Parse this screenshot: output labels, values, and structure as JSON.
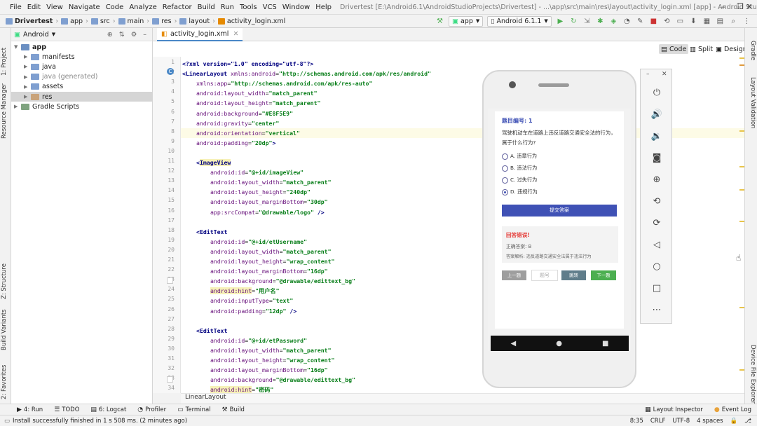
{
  "menubar": {
    "items": [
      "File",
      "Edit",
      "View",
      "Navigate",
      "Code",
      "Analyze",
      "Refactor",
      "Build",
      "Run",
      "Tools",
      "VCS",
      "Window",
      "Help"
    ],
    "title": "Drivertest [E:\\Android6.1\\AndroidStudioProjects\\Drivertest] - ...\\app\\src\\main\\res\\layout\\activity_login.xml [app] - Android Studio"
  },
  "breadcrumbs": [
    "Drivertest",
    "app",
    "src",
    "main",
    "res",
    "layout",
    "activity_login.xml"
  ],
  "toolbar": {
    "run_config": "app",
    "device": "Android 6.1.1"
  },
  "project": {
    "view_label": "Android",
    "tree": [
      {
        "label": "app",
        "indent": 0,
        "expanded": true,
        "bold": true,
        "color": "#6b8fc2"
      },
      {
        "label": "manifests",
        "indent": 1,
        "color": "#7f9fd0"
      },
      {
        "label": "java",
        "indent": 1,
        "color": "#7f9fd0"
      },
      {
        "label": "java (generated)",
        "indent": 1,
        "color": "#7f9fd0",
        "muted": true
      },
      {
        "label": "assets",
        "indent": 1,
        "color": "#7f9fd0"
      },
      {
        "label": "res",
        "indent": 1,
        "color": "#c9a37a",
        "selected": true
      },
      {
        "label": "Gradle Scripts",
        "indent": 0,
        "color": "#7fa37f"
      }
    ]
  },
  "side_tabs_left": [
    "1: Project",
    "Resource Manager",
    "Z: Structure",
    "Build Variants",
    "2: Favorites"
  ],
  "side_tabs_right": [
    "Gradle",
    "Layout Validation",
    "Device File Explorer"
  ],
  "editor": {
    "tab": "activity_login.xml",
    "modes": [
      "Code",
      "Split",
      "Design"
    ],
    "footer": "LinearLayout",
    "start_line": 1,
    "lines": [
      {
        "i": 0,
        "t": [
          [
            "<?xml version=\"1.0\" encoding=\"utf-8\"?>",
            "tg"
          ]
        ]
      },
      {
        "i": 0,
        "t": [
          [
            "<LinearLayout ",
            "tg"
          ],
          [
            "xmlns:android",
            "at"
          ],
          [
            "=",
            "t"
          ],
          [
            "\"http://schemas.android.com/apk/res/android\"",
            "vl"
          ]
        ]
      },
      {
        "i": 1,
        "t": [
          [
            "xmlns:app",
            "at"
          ],
          [
            "=",
            "t"
          ],
          [
            "\"http://schemas.android.com/apk/res-auto\"",
            "vl"
          ]
        ]
      },
      {
        "i": 1,
        "t": [
          [
            "android:layout_width",
            "at"
          ],
          [
            "=",
            "t"
          ],
          [
            "\"match_parent\"",
            "vl"
          ]
        ]
      },
      {
        "i": 1,
        "t": [
          [
            "android:layout_height",
            "at"
          ],
          [
            "=",
            "t"
          ],
          [
            "\"match_parent\"",
            "vl"
          ]
        ]
      },
      {
        "i": 1,
        "t": [
          [
            "android:background",
            "at"
          ],
          [
            "=",
            "t"
          ],
          [
            "\"#E8F5E9\"",
            "vl"
          ]
        ]
      },
      {
        "i": 1,
        "t": [
          [
            "android:gravity",
            "at"
          ],
          [
            "=",
            "t"
          ],
          [
            "\"center\"",
            "vl"
          ]
        ]
      },
      {
        "i": 1,
        "t": [
          [
            "android:orientation",
            "at"
          ],
          [
            "=",
            "t"
          ],
          [
            "\"vertical\"",
            "vl"
          ]
        ],
        "hl": true
      },
      {
        "i": 1,
        "t": [
          [
            "android:padding",
            "at"
          ],
          [
            "=",
            "t"
          ],
          [
            "\"20dp\"",
            "vl"
          ],
          [
            ">",
            "tg"
          ]
        ]
      },
      {
        "i": 0,
        "t": []
      },
      {
        "i": 1,
        "t": [
          [
            "<",
            "tg"
          ],
          [
            "ImageView",
            "tg hlyellow"
          ]
        ]
      },
      {
        "i": 2,
        "t": [
          [
            "android:id",
            "at"
          ],
          [
            "=",
            "t"
          ],
          [
            "\"@+id/imageView\"",
            "vl"
          ]
        ]
      },
      {
        "i": 2,
        "t": [
          [
            "android:layout_width",
            "at"
          ],
          [
            "=",
            "t"
          ],
          [
            "\"match_parent\"",
            "vl"
          ]
        ]
      },
      {
        "i": 2,
        "t": [
          [
            "android:layout_height",
            "at"
          ],
          [
            "=",
            "t"
          ],
          [
            "\"240dp\"",
            "vl"
          ]
        ]
      },
      {
        "i": 2,
        "t": [
          [
            "android:layout_marginBottom",
            "at"
          ],
          [
            "=",
            "t"
          ],
          [
            "\"30dp\"",
            "vl"
          ]
        ]
      },
      {
        "i": 2,
        "t": [
          [
            "app:srcCompat",
            "at"
          ],
          [
            "=",
            "t"
          ],
          [
            "\"@drawable/logo\"",
            "vl"
          ],
          [
            " />",
            "tg"
          ]
        ]
      },
      {
        "i": 0,
        "t": []
      },
      {
        "i": 1,
        "t": [
          [
            "<",
            "tg"
          ],
          [
            "EditText",
            "tg"
          ]
        ]
      },
      {
        "i": 2,
        "t": [
          [
            "android:id",
            "at"
          ],
          [
            "=",
            "t"
          ],
          [
            "\"@+id/etUsername\"",
            "vl"
          ]
        ]
      },
      {
        "i": 2,
        "t": [
          [
            "android:layout_width",
            "at"
          ],
          [
            "=",
            "t"
          ],
          [
            "\"match_parent\"",
            "vl"
          ]
        ]
      },
      {
        "i": 2,
        "t": [
          [
            "android:layout_height",
            "at"
          ],
          [
            "=",
            "t"
          ],
          [
            "\"wrap_content\"",
            "vl"
          ]
        ]
      },
      {
        "i": 2,
        "t": [
          [
            "android:layout_marginBottom",
            "at"
          ],
          [
            "=",
            "t"
          ],
          [
            "\"16dp\"",
            "vl"
          ]
        ]
      },
      {
        "i": 2,
        "t": [
          [
            "android:background",
            "at"
          ],
          [
            "=",
            "t"
          ],
          [
            "\"@drawable/edittext_bg\"",
            "vl"
          ]
        ]
      },
      {
        "i": 2,
        "t": [
          [
            "android:hint",
            "at hlyellow"
          ],
          [
            "=",
            "t"
          ],
          [
            "\"用户名\"",
            "vl"
          ]
        ]
      },
      {
        "i": 2,
        "t": [
          [
            "android:inputType",
            "at"
          ],
          [
            "=",
            "t"
          ],
          [
            "\"text\"",
            "vl"
          ]
        ]
      },
      {
        "i": 2,
        "t": [
          [
            "android:padding",
            "at"
          ],
          [
            "=",
            "t"
          ],
          [
            "\"12dp\"",
            "vl"
          ],
          [
            " />",
            "tg"
          ]
        ]
      },
      {
        "i": 0,
        "t": []
      },
      {
        "i": 1,
        "t": [
          [
            "<",
            "tg"
          ],
          [
            "EditText",
            "tg"
          ]
        ]
      },
      {
        "i": 2,
        "t": [
          [
            "android:id",
            "at"
          ],
          [
            "=",
            "t"
          ],
          [
            "\"@+id/etPassword\"",
            "vl"
          ]
        ]
      },
      {
        "i": 2,
        "t": [
          [
            "android:layout_width",
            "at"
          ],
          [
            "=",
            "t"
          ],
          [
            "\"match_parent\"",
            "vl"
          ]
        ]
      },
      {
        "i": 2,
        "t": [
          [
            "android:layout_height",
            "at"
          ],
          [
            "=",
            "t"
          ],
          [
            "\"wrap_content\"",
            "vl"
          ]
        ]
      },
      {
        "i": 2,
        "t": [
          [
            "android:layout_marginBottom",
            "at"
          ],
          [
            "=",
            "t"
          ],
          [
            "\"16dp\"",
            "vl"
          ]
        ]
      },
      {
        "i": 2,
        "t": [
          [
            "android:background",
            "at"
          ],
          [
            "=",
            "t"
          ],
          [
            "\"@drawable/edittext_bg\"",
            "vl"
          ]
        ]
      },
      {
        "i": 2,
        "t": [
          [
            "android:hint",
            "at hlyellow"
          ],
          [
            "=",
            "t"
          ],
          [
            "\"密码\"",
            "vl"
          ]
        ]
      }
    ]
  },
  "quiz": {
    "question_number": "题目编号: 1",
    "question": "驾驶机动车在道路上违反道路交通安全法的行为，属于什么行为?",
    "options": [
      {
        "label": "A. 违章行为",
        "checked": false
      },
      {
        "label": "B. 违法行为",
        "checked": false
      },
      {
        "label": "C. 过失行为",
        "checked": false
      },
      {
        "label": "D. 违规行为",
        "checked": true
      }
    ],
    "submit": "提交答案",
    "result_title": "回答错误!",
    "correct_answer": "正确答案: B",
    "explanation": "答案解析: 违反道路交通安全法属于违法行为",
    "prev": "上一题",
    "jump_placeholder": "题号",
    "jump": "跳转",
    "next": "下一题"
  },
  "colors": {
    "primary": "#3f51b5",
    "error": "#e53935",
    "next_green": "#4caf50",
    "jump_gray": "#607d8b",
    "prev_gray": "#9e9e9e"
  },
  "bottom_tabs": [
    {
      "label": "4: Run",
      "icon": "run-icon"
    },
    {
      "label": "TODO",
      "icon": "todo-icon"
    },
    {
      "label": "6: Logcat",
      "icon": "logcat-icon"
    },
    {
      "label": "Profiler",
      "icon": "profiler-icon"
    },
    {
      "label": "Terminal",
      "icon": "terminal-icon"
    },
    {
      "label": "Build",
      "icon": "build-icon"
    }
  ],
  "bottom_right": {
    "layout_inspector": "Layout Inspector",
    "event_log": "Event Log"
  },
  "status": {
    "message": "Install successfully finished in 1 s 508 ms. (2 minutes ago)",
    "position": "8:35",
    "line_sep": "CRLF",
    "encoding": "UTF-8",
    "indent": "4 spaces"
  }
}
